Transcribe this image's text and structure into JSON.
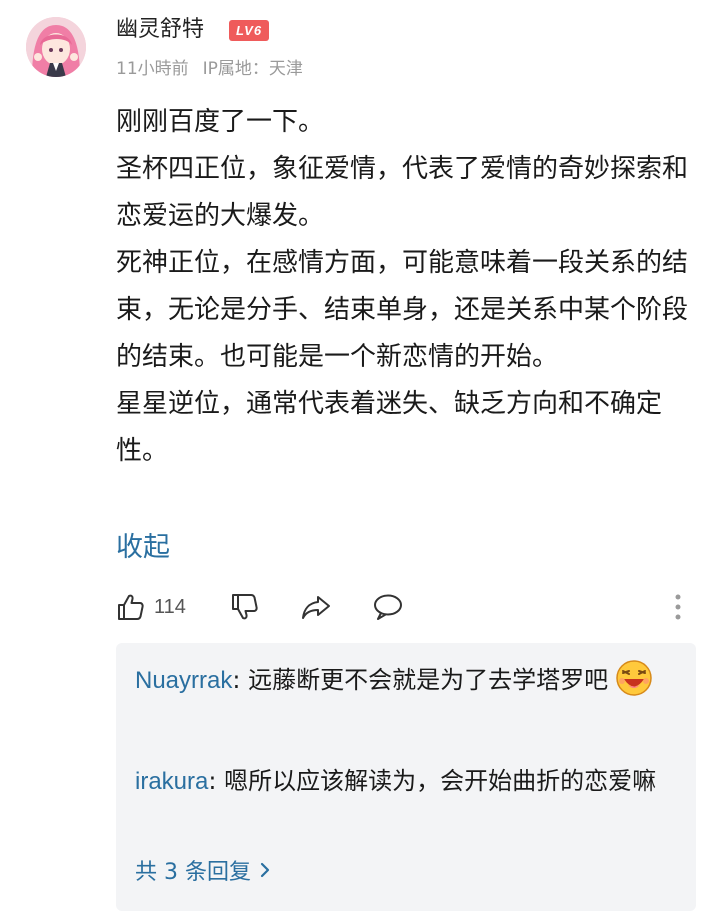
{
  "comment": {
    "username": "幽灵舒特",
    "level_badge": "LV6",
    "time": "11小時前",
    "ip_location": "IP属地：天津",
    "paragraphs": [
      "刚刚百度了一下。",
      "圣杯四正位，象征爱情，代表了爱情的奇妙探索和恋爱运的大爆发。",
      "死神正位，在感情方面，可能意味着一段关系的结束，无论是分手、结束单身，还是关系中某个阶段的结束。也可能是一个新恋情的开始。",
      "星星逆位，通常代表着迷失、缺乏方向和不确定性。"
    ],
    "collapse_label": "收起",
    "like_count": "114"
  },
  "actions_icons": [
    "thumbs-up-icon",
    "thumbs-down-icon",
    "share-icon",
    "comment-icon",
    "more-icon"
  ],
  "replies": [
    {
      "author": "Nuayrrak",
      "text": "远藤断更不会就是为了去学塔罗吧",
      "emoji": "laughing-emoji-icon"
    },
    {
      "author": "irakura",
      "text": "嗯所以应该解读为，会开始曲折的恋爱嘛"
    }
  ],
  "more_replies_label": "共 3 条回复",
  "colors": {
    "link": "#2a6fa0",
    "badge": "#ef5b5b",
    "reply_bg": "#f3f4f6",
    "meta": "#9a9a9a"
  }
}
